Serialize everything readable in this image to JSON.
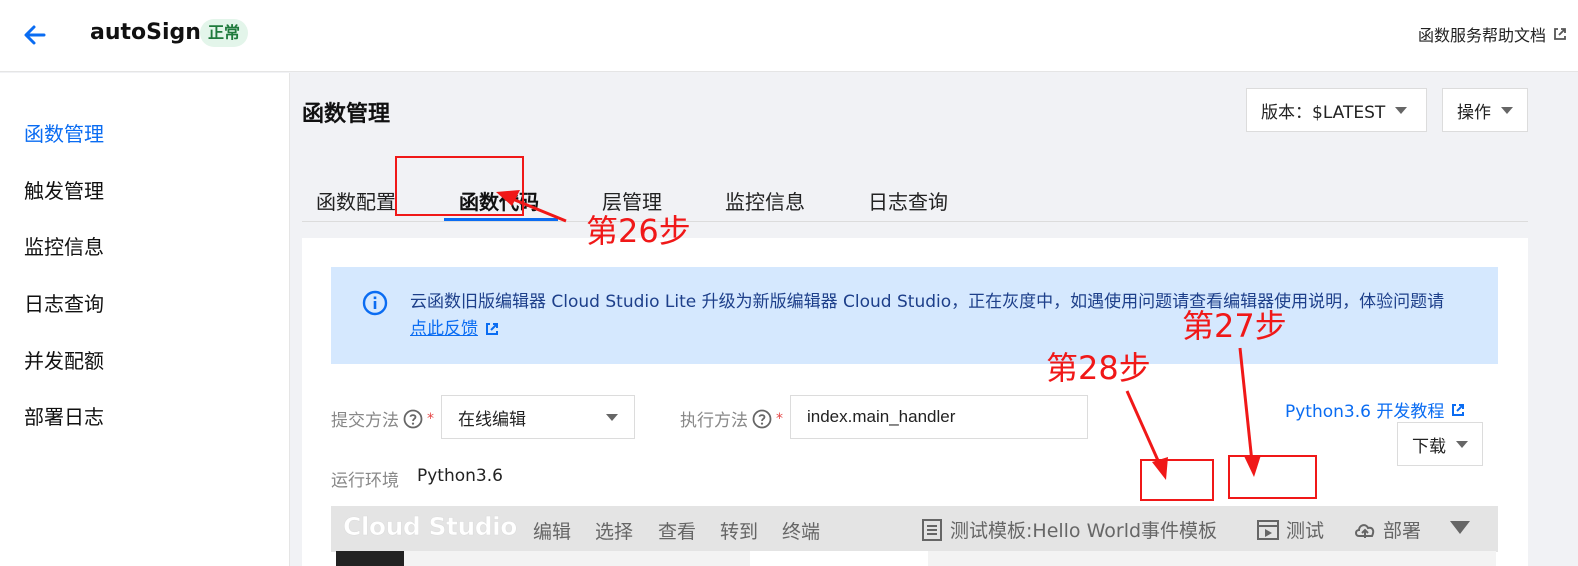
{
  "header": {
    "app_name": "autoSign",
    "status": "正常",
    "help_link": "函数服务帮助文档"
  },
  "sidebar": {
    "items": [
      {
        "label": "函数管理",
        "active": true
      },
      {
        "label": "触发管理"
      },
      {
        "label": "监控信息"
      },
      {
        "label": "日志查询"
      },
      {
        "label": "并发配额"
      },
      {
        "label": "部署日志"
      }
    ]
  },
  "main": {
    "title": "函数管理",
    "version_label": "版本：$LATEST",
    "actions_label": "操作",
    "tabs": [
      {
        "label": "函数配置"
      },
      {
        "label": "函数代码",
        "active": true
      },
      {
        "label": "层管理"
      },
      {
        "label": "监控信息"
      },
      {
        "label": "日志查询"
      }
    ]
  },
  "notice": {
    "text": "云函数旧版编辑器 Cloud Studio Lite 升级为新版编辑器 Cloud Studio，正在灰度中，如遇使用问题请查看编辑器使用说明，体验问题请",
    "link": "点此反馈"
  },
  "form": {
    "submit_label": "提交方法",
    "submit_value": "在线编辑",
    "exec_label": "执行方法",
    "exec_value": "index.main_handler",
    "tutorial_link": "Python3.6 开发教程",
    "download_label": "下载",
    "runtime_label": "运行环境",
    "runtime_value": "Python3.6"
  },
  "studio": {
    "logo": "Cloud Studio",
    "menu": [
      "编辑",
      "选择",
      "查看",
      "转到",
      "终端"
    ],
    "template_label": "测试模板:Hello World事件模板",
    "test_label": "测试",
    "deploy_label": "部署"
  },
  "annotations": {
    "step26": "第26步",
    "step27": "第27步",
    "step28": "第28步"
  },
  "colors": {
    "accent": "#0a6cf2",
    "annotation": "#f01818",
    "notice_bg": "#d5e8fe",
    "status_bg": "#e3f5ea"
  }
}
